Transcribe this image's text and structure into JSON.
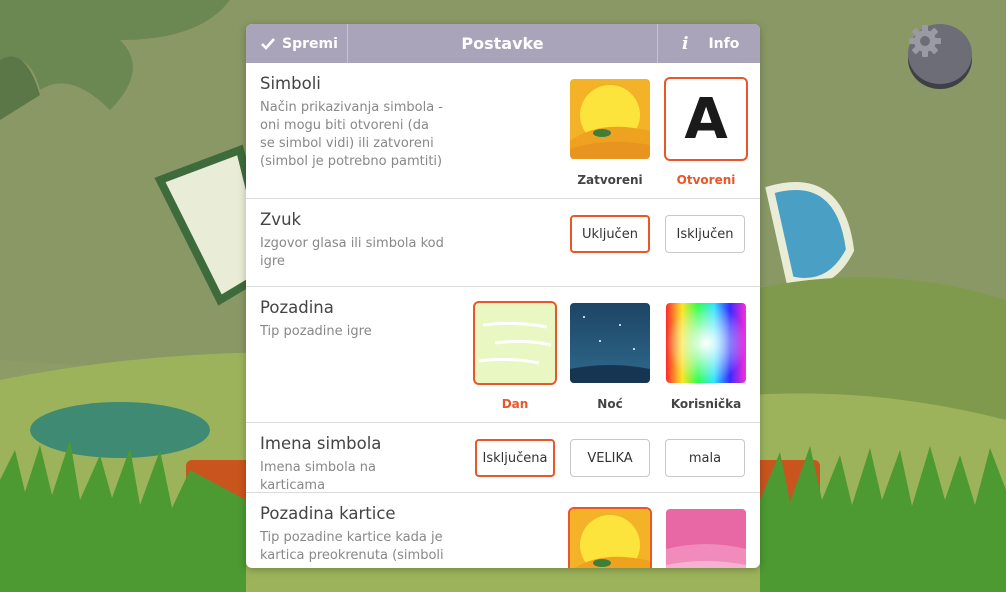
{
  "titlebar": {
    "save_label": "Spremi",
    "title": "Postavke",
    "info_glyph": "i",
    "info_label": "Info"
  },
  "sections": {
    "symbols": {
      "title": "Simboli",
      "desc": "Način prikazivanja simbola - oni mogu biti otvoreni (da se simbol vidi) ili zatvoreni (simbol je potrebno pamtiti)",
      "options": [
        {
          "label": "Zatvoreni",
          "selected": false
        },
        {
          "label": "Otvoreni",
          "selected": true,
          "glyph": "A"
        }
      ]
    },
    "sound": {
      "title": "Zvuk",
      "desc": "Izgovor glasa ili simbola kod igre",
      "options": [
        {
          "label": "Uključen",
          "selected": true
        },
        {
          "label": "Isključen",
          "selected": false
        }
      ]
    },
    "background": {
      "title": "Pozadina",
      "desc": "Tip pozadine igre",
      "options": [
        {
          "label": "Dan",
          "selected": true
        },
        {
          "label": "Noć",
          "selected": false
        },
        {
          "label": "Korisnička",
          "selected": false
        }
      ]
    },
    "names": {
      "title": "Imena simbola",
      "desc": "Imena simbola na karticama",
      "options": [
        {
          "label": "Isključena",
          "selected": true
        },
        {
          "label": "VELIKA",
          "selected": false
        },
        {
          "label": "mala",
          "selected": false
        }
      ]
    },
    "card_bg": {
      "title": "Pozadina kartice",
      "desc": "Tip pozadine kartice kada je kartica preokrenuta (simboli"
    }
  },
  "colors": {
    "accent": "#e8562a",
    "titlebar": "#a9a4ba"
  },
  "icons": {
    "save": "check-icon",
    "info": "info-icon",
    "settings": "gear-icon"
  }
}
